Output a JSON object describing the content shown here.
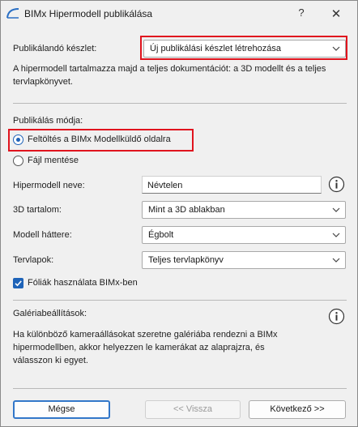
{
  "window": {
    "title": "BIMx Hipermodell publikálása",
    "help_glyph": "?",
    "close_glyph": "✕"
  },
  "publish_set": {
    "label": "Publikálandó készlet:",
    "value": "Új publikálási készlet létrehozása",
    "description": "A hipermodell tartalmazza majd a teljes dokumentációt: a 3D modellt és a teljes tervlapkönyvet."
  },
  "publish_mode": {
    "label": "Publikálás módja:",
    "options": [
      {
        "label": "Feltöltés a BIMx Modellküldő oldalra",
        "selected": true
      },
      {
        "label": "Fájl mentése",
        "selected": false
      }
    ]
  },
  "form": {
    "name_label": "Hipermodell neve:",
    "name_value": "Névtelen",
    "content_label": "3D tartalom:",
    "content_value": "Mint a 3D ablakban",
    "background_label": "Modell háttere:",
    "background_value": "Égbolt",
    "layouts_label": "Tervlapok:",
    "layouts_value": "Teljes tervlapkönyv",
    "layers_check_label": "Fóliák használata BIMx-ben",
    "layers_checked": true
  },
  "gallery": {
    "label": "Galériabeállítások:",
    "description": "Ha különböző kameraállásokat szeretne galériába rendezni a BIMx hipermodellben, akkor helyezzen le kamerákat az alaprajzra, és válasszon ki egyet."
  },
  "buttons": {
    "cancel": "Mégse",
    "back": "<< Vissza",
    "next": "Következő >>"
  },
  "icons": {
    "app": "bimx-arc-icon",
    "info": "info-icon",
    "chevron": "chevron-down-icon",
    "check": "checkmark-icon"
  },
  "colors": {
    "accent": "#1e63b8",
    "highlight_box": "#e0141e",
    "default_button_border": "#3277c9"
  }
}
